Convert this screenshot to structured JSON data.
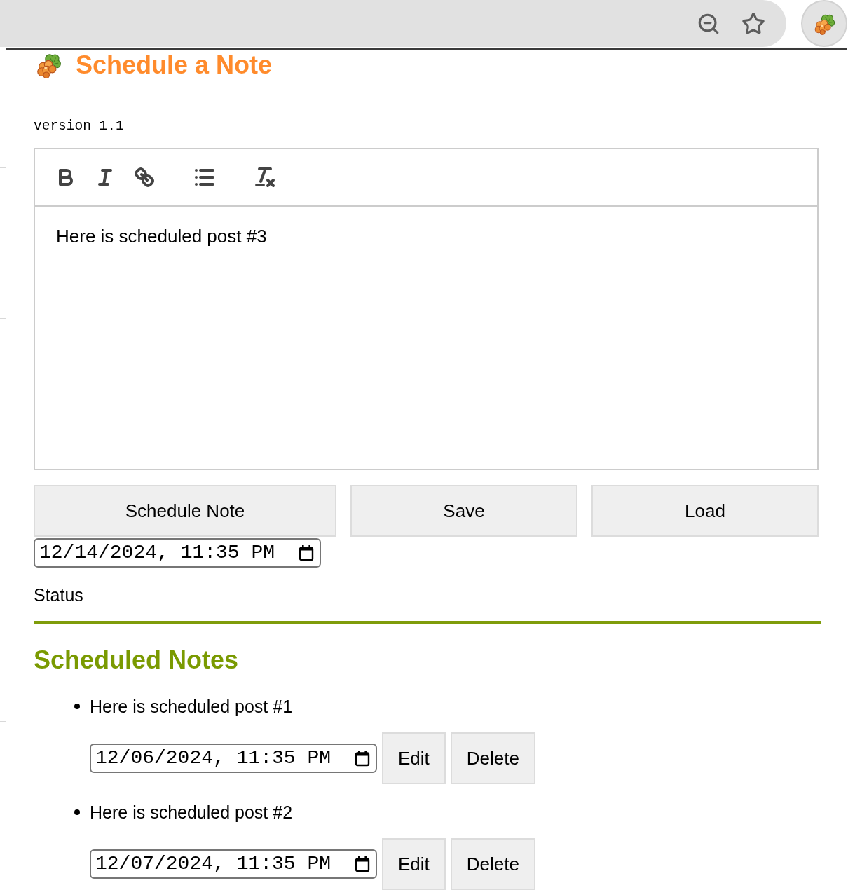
{
  "popup": {
    "title": "Schedule a Note",
    "version": "version 1.1"
  },
  "editor": {
    "content": "Here is scheduled post #3"
  },
  "actions": [
    "Schedule Note",
    "Save",
    "Load"
  ],
  "schedule_time": {
    "value": "12/14/2024, 11:35 PM"
  },
  "status": "Status",
  "scheduled_notes": {
    "heading": "Scheduled Notes",
    "items": [
      {
        "text": "Here is scheduled post #1",
        "time": "12/06/2024, 11:35 PM",
        "buttons": [
          "Edit",
          "Delete"
        ]
      },
      {
        "text": "Here is scheduled post #2",
        "time": "12/07/2024, 11:35 PM",
        "buttons": [
          "Edit",
          "Delete"
        ]
      }
    ]
  }
}
